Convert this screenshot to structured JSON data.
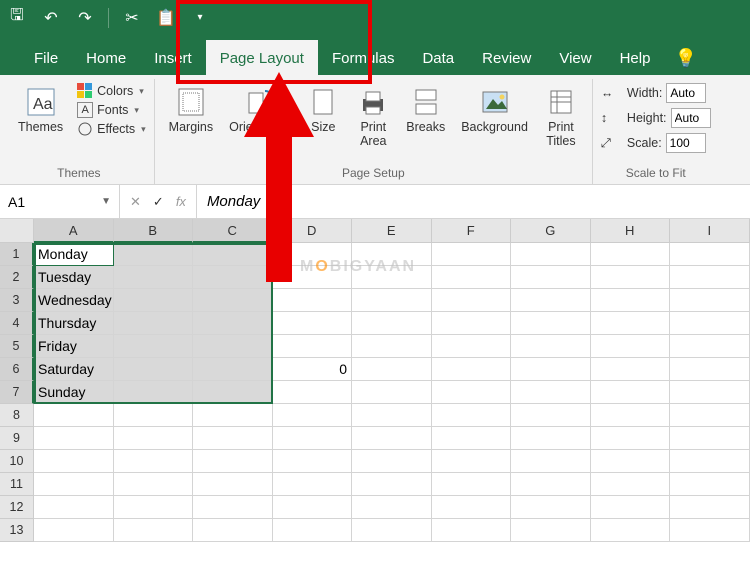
{
  "qat": {
    "save": "🖫",
    "undo": "↶",
    "redo": "↷",
    "cut": "✂",
    "paste": "📋",
    "more": "▾"
  },
  "tabs": {
    "file": "File",
    "home": "Home",
    "insert": "Insert",
    "pagelayout": "Page Layout",
    "formulas": "Formulas",
    "data": "Data",
    "review": "Review",
    "view": "View",
    "help": "Help"
  },
  "ribbon": {
    "themes": {
      "label": "Themes",
      "themes_btn": "Themes",
      "colors": "Colors",
      "fonts": "Fonts",
      "effects": "Effects"
    },
    "pagesetup": {
      "label": "Page Setup",
      "margins": "Margins",
      "orientation": "Orientation",
      "size": "Size",
      "printarea": "Print\nArea",
      "breaks": "Breaks",
      "background": "Background",
      "printtitles": "Print\nTitles"
    },
    "scaletofit": {
      "label": "Scale to Fit",
      "width_lbl": "Width:",
      "width_val": "Auto",
      "height_lbl": "Height:",
      "height_val": "Auto",
      "scale_lbl": "Scale:",
      "scale_val": "100"
    }
  },
  "namebox": "A1",
  "formula_bar": "Monday",
  "columns": [
    "A",
    "B",
    "C",
    "D",
    "E",
    "F",
    "G",
    "H",
    "I"
  ],
  "sel_cols": 3,
  "sel_rows": 7,
  "rows": 13,
  "cells": {
    "A1": "Monday",
    "A2": "Tuesday",
    "A3": "Wednesday",
    "A4": "Thursday",
    "A5": "Friday",
    "A6": "Saturday",
    "A7": "Sunday",
    "D6": "0"
  },
  "watermark": {
    "left": "M",
    "o": "O",
    "right": "BIGYAAN"
  }
}
